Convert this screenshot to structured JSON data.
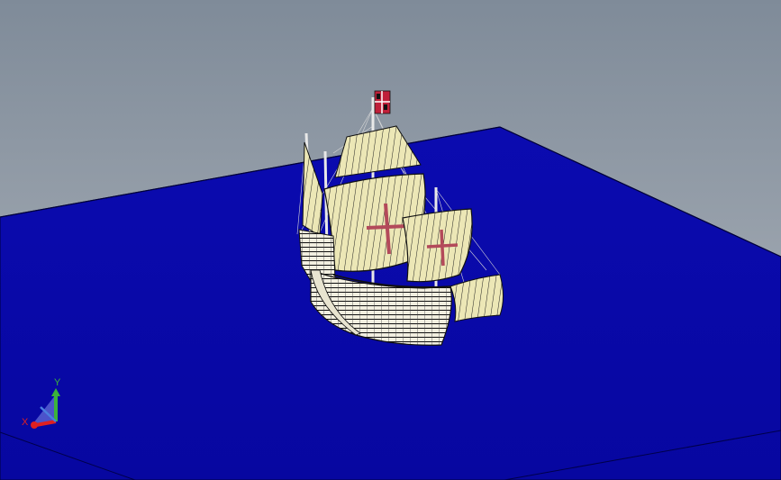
{
  "viewport": {
    "background_top": "#7f8b99",
    "background_bottom": "#a9b0b8"
  },
  "ocean": {
    "color": "#0a0aa6",
    "edge_color": "#000040"
  },
  "ship": {
    "hull_color": "#f4f1e0",
    "line_color": "#1a1a1a",
    "sail_color": "#ece7b6",
    "cross_color": "#b34a5a",
    "flag_color": "#c0203a"
  },
  "triad": {
    "y_label": "Y",
    "x_label": "X",
    "y_color": "#3bb33b",
    "x_color": "#e02020",
    "z_color": "#4a7fe0"
  }
}
